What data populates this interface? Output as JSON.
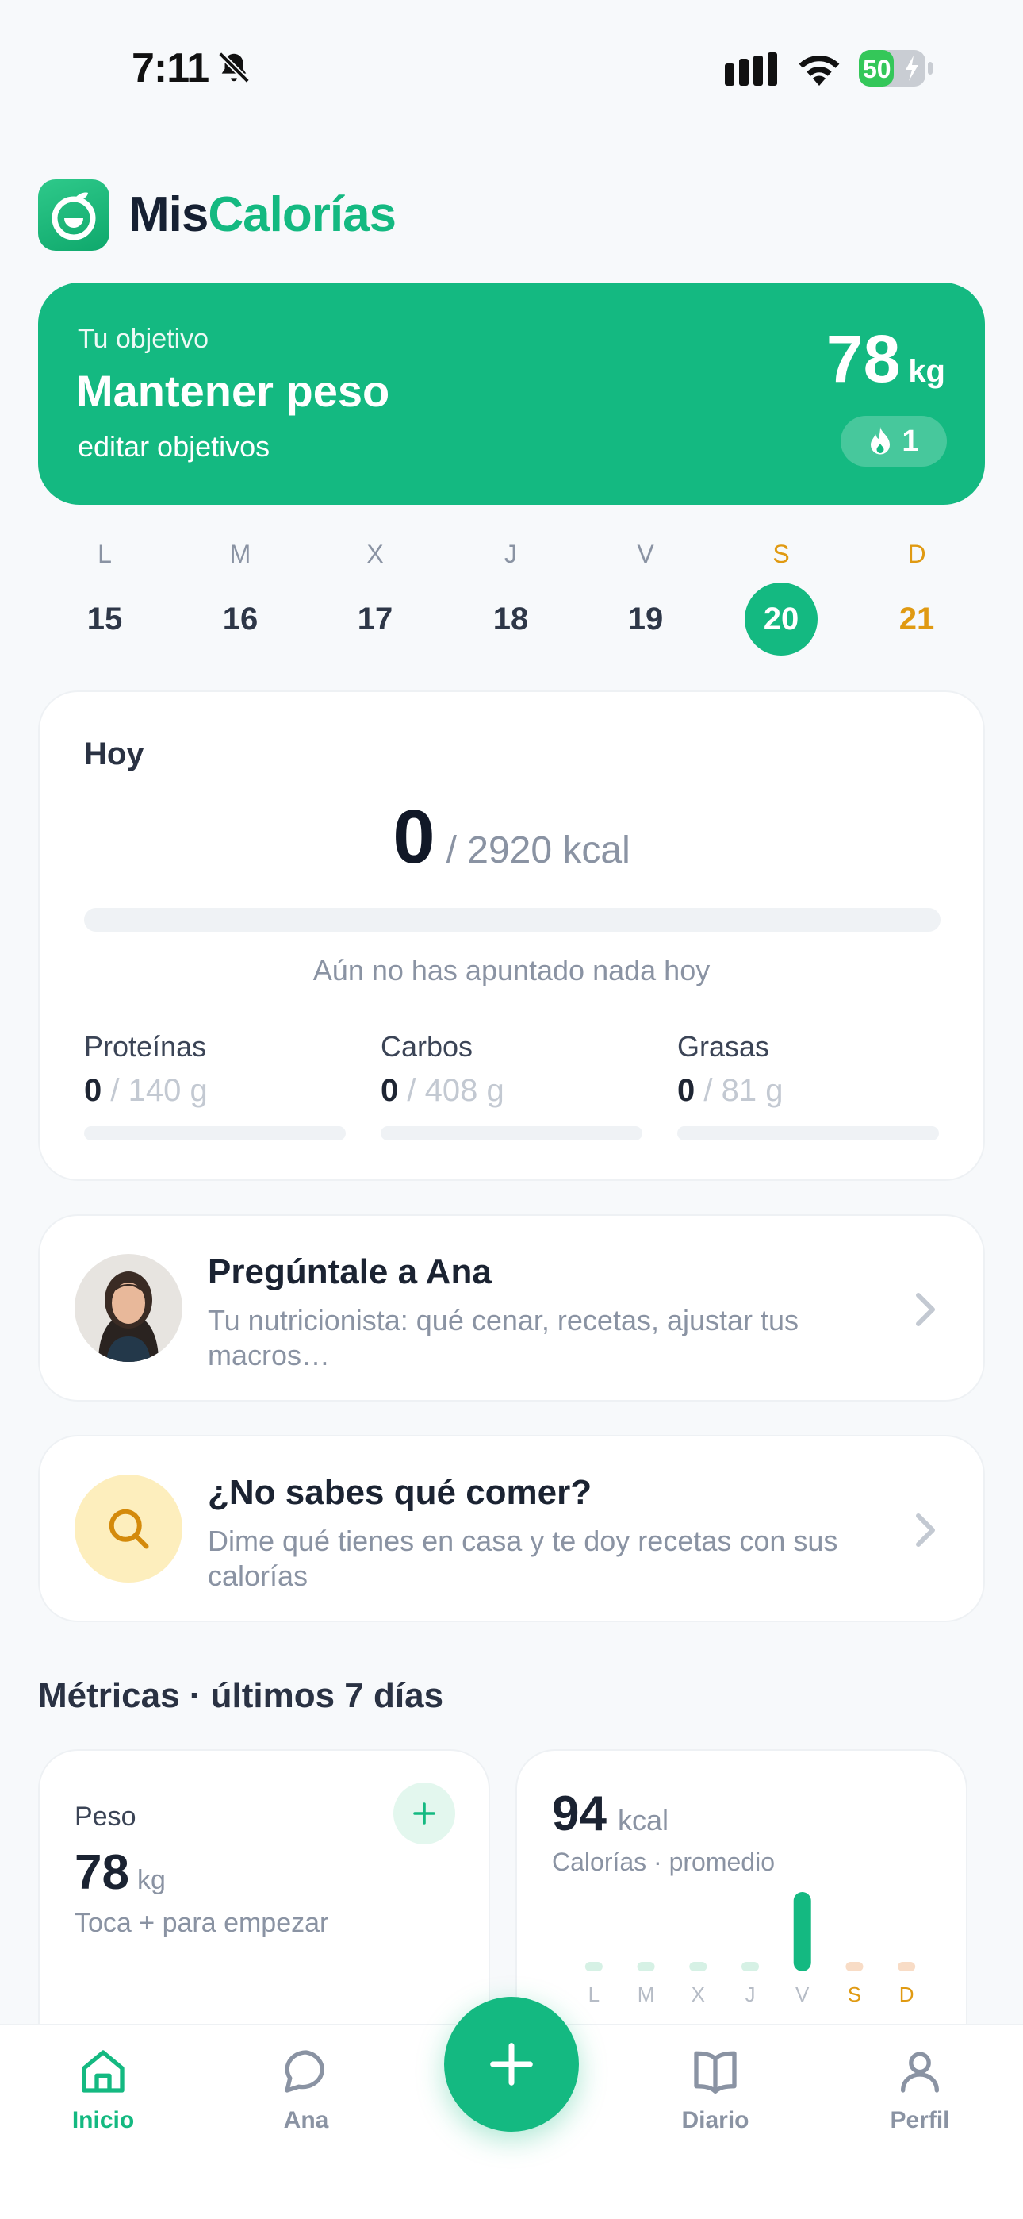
{
  "status_bar": {
    "time": "7:11",
    "battery": "50"
  },
  "header": {
    "title_part1": "Mis",
    "title_part2": "Calorías"
  },
  "goal": {
    "label": "Tu objetivo",
    "title": "Mantener peso",
    "edit_link": "editar objetivos",
    "weight_value": "78",
    "weight_unit": "kg",
    "streak_count": "1"
  },
  "week": [
    {
      "letter": "L",
      "num": "15"
    },
    {
      "letter": "M",
      "num": "16"
    },
    {
      "letter": "X",
      "num": "17"
    },
    {
      "letter": "J",
      "num": "18"
    },
    {
      "letter": "V",
      "num": "19"
    },
    {
      "letter": "S",
      "num": "20"
    },
    {
      "letter": "D",
      "num": "21"
    }
  ],
  "today": {
    "title": "Hoy",
    "consumed": "0",
    "target_text": "/ 2920 kcal",
    "empty_note": "Aún no has apuntado nada hoy",
    "macros": [
      {
        "name": "Proteínas",
        "value": "0",
        "target": " / 140 g"
      },
      {
        "name": "Carbos",
        "value": "0",
        "target": " / 408 g"
      },
      {
        "name": "Grasas",
        "value": "0",
        "target": " / 81 g"
      }
    ]
  },
  "ask_ana": {
    "title": "Pregúntale a Ana",
    "subtitle": "Tu nutricionista: qué cenar, recetas, ajustar tus macros…"
  },
  "recipes": {
    "title": "¿No sabes qué comer?",
    "subtitle": "Dime qué tienes en casa y te doy recetas con sus calorías"
  },
  "metrics": {
    "title": "Métricas · últimos 7 días",
    "weight": {
      "label": "Peso",
      "value": "78",
      "unit": "kg",
      "note": "Toca + para empezar"
    },
    "calories": {
      "value": "94",
      "unit": "kcal",
      "subtitle": "Calorías · promedio",
      "days": [
        "L",
        "M",
        "X",
        "J",
        "V",
        "S",
        "D"
      ],
      "values": [
        0,
        0,
        0,
        0,
        94,
        0,
        0
      ]
    }
  },
  "tabs": {
    "home": "Inicio",
    "ana": "Ana",
    "diary": "Diario",
    "profile": "Perfil"
  },
  "colors": {
    "accent": "#14b981",
    "weekend": "#e09a12"
  }
}
